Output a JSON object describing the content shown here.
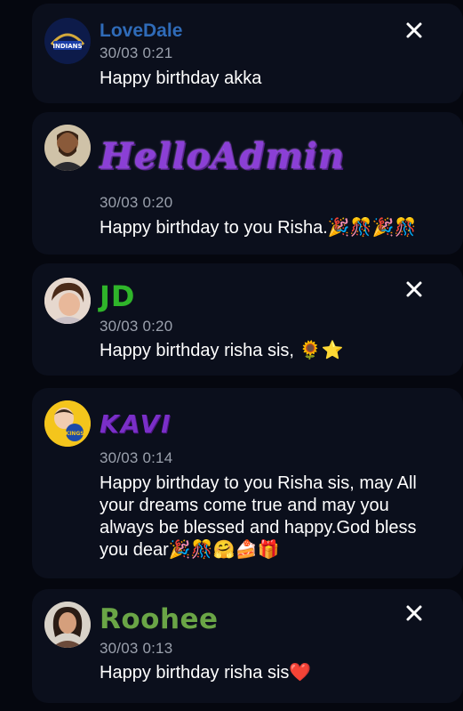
{
  "posts": [
    {
      "name": "LoveDale",
      "time": "30/03 0:21",
      "message": "Happy birthday akka",
      "avatar": "mumbai-indians-logo",
      "has_close": true
    },
    {
      "name": "HelloAdmin",
      "time": "30/03 0:20",
      "message": "Happy birthday to you Risha.🎉🎊🎉🎊",
      "avatar": "bearded-man-photo",
      "has_close": false
    },
    {
      "name": "JD",
      "time": "30/03 0:20",
      "message": "Happy birthday risha sis, 🌻⭐",
      "avatar": "young-man-photo",
      "has_close": true
    },
    {
      "name": "KAVI",
      "time": "30/03 0:14",
      "message": "Happy birthday to you Risha sis, may All your dreams come true and may you always be blessed and happy.God bless you dear🎉🎊🤗🍰🎁",
      "avatar": "super-kings-baby-photo",
      "has_close": false
    },
    {
      "name": "Roohee",
      "time": "30/03 0:13",
      "message": "Happy birthday risha sis❤️",
      "avatar": "woman-photo",
      "has_close": true
    }
  ],
  "colors": {
    "background": "#05070f",
    "card": "#0b0f1c",
    "lovedale": "#2f6bb8",
    "helloadmin": "#8b3fd6",
    "jd": "#2fb52a",
    "kavi": "#7a2fc8",
    "roohee": "#6aa546",
    "timestamp": "#9aa0ac"
  }
}
